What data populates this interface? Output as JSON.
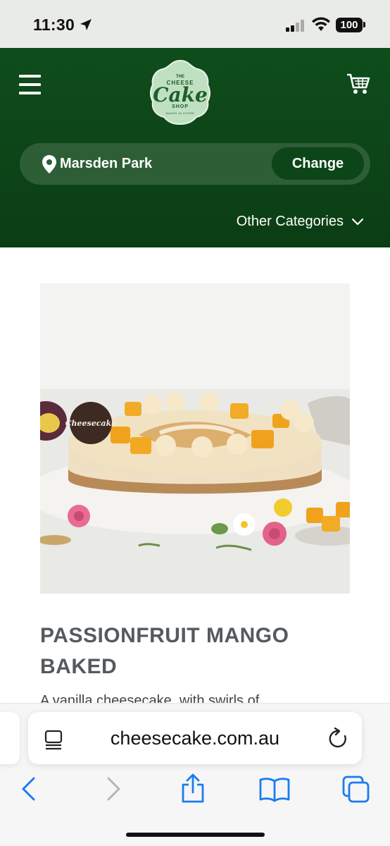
{
  "status_bar": {
    "time": "11:30",
    "battery": "100"
  },
  "header": {
    "menu_icon": "hamburger-menu-icon",
    "logo": {
      "the": "THE",
      "cheese": "CHEESE",
      "cake": "Cake",
      "shop": "SHOP",
      "tagline": "BAKED IN STORE"
    },
    "cart_icon": "shopping-cart-icon",
    "store": {
      "name": "Marsden Park",
      "change_label": "Change"
    },
    "other_categories_label": "Other Categories"
  },
  "product": {
    "image_alt": "Passionfruit mango baked cheesecake",
    "title": "PASSIONFRUIT MANGO BAKED",
    "description_partial": "A vanilla cheesecake, with swirls of"
  },
  "browser": {
    "url": "cheesecake.com.au"
  },
  "colors": {
    "header_green": "#0f4d1c",
    "store_bar": "#2e5e36",
    "change_button": "#0c4518",
    "safari_blue": "#1a7cf0",
    "title_grey": "#555a5e"
  }
}
